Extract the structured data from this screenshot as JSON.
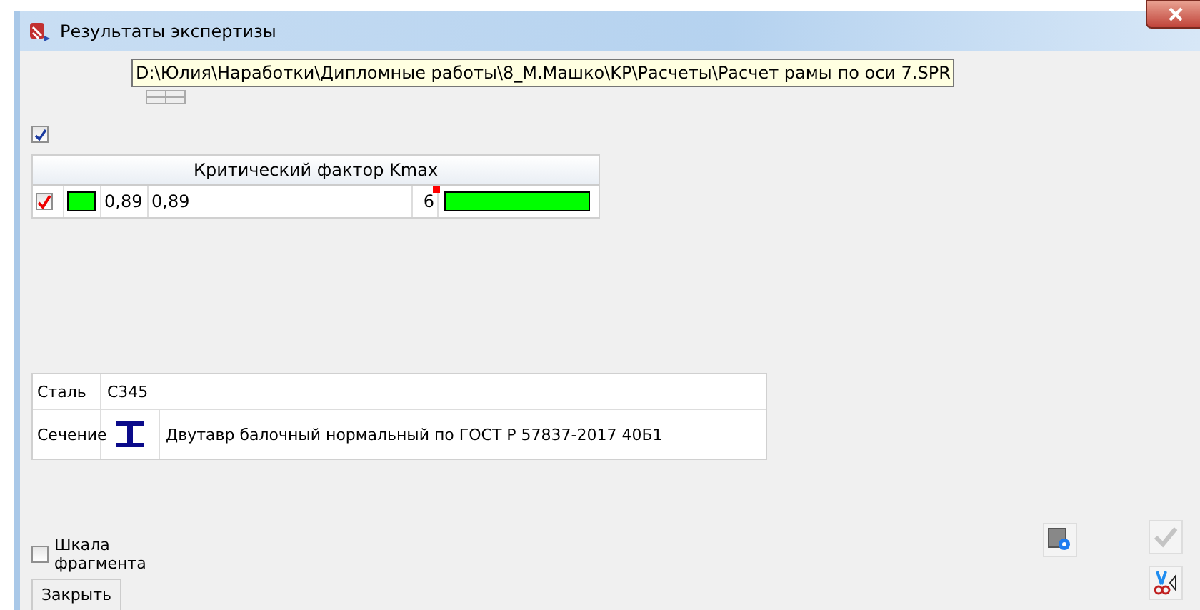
{
  "window": {
    "title": "Результаты экспертизы"
  },
  "tooltip": "D:\\Юлия\\Наработки\\Дипломные работы\\8_М.Машко\\KP\\Расчеты\\Расчет рамы по оси 7.SPR",
  "show_table": {
    "checked": true
  },
  "factor_table": {
    "header": "Критический фактор Kmax",
    "rows": [
      {
        "checked": true,
        "color": "#00ff00",
        "column_3": "0,89",
        "column_4": "0,89",
        "column_5": "6",
        "flagged": true,
        "level": 1
      }
    ]
  },
  "properties": [
    {
      "label": "Сталь",
      "value": "С345"
    },
    {
      "label": "Сечение",
      "kind": "i-beam",
      "value": "Двутавр балочный нормальный по ГОСТ Р 57837-2017 40Б1"
    }
  ],
  "fragment_scale": {
    "label": "Шкала фрагмента",
    "checked": false
  },
  "close_button": "Закрыть",
  "apply": {
    "disabled": true
  }
}
